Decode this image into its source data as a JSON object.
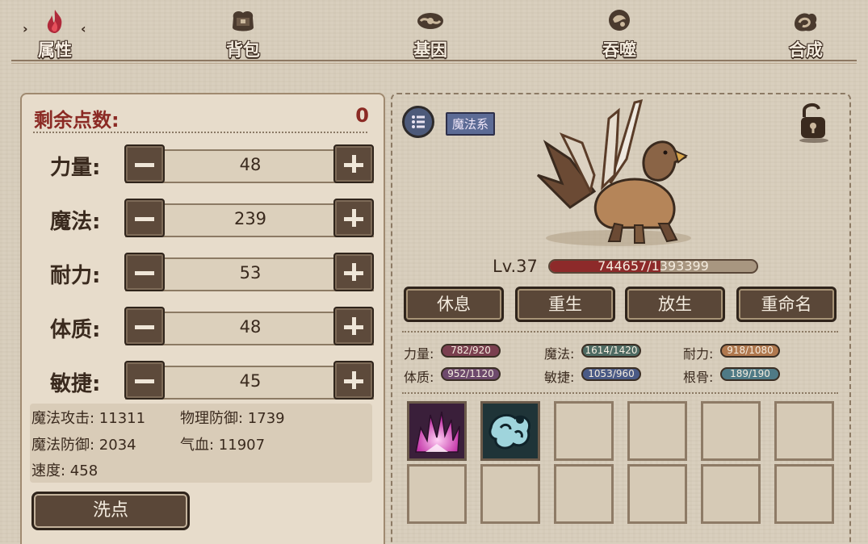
{
  "tabs": [
    {
      "label": "属性",
      "icon": "flame-icon",
      "active": true
    },
    {
      "label": "背包",
      "icon": "bag-icon",
      "active": false
    },
    {
      "label": "基因",
      "icon": "gene-icon",
      "active": false
    },
    {
      "label": "吞噬",
      "icon": "devour-icon",
      "active": false
    },
    {
      "label": "合成",
      "icon": "synthesis-icon",
      "active": false
    }
  ],
  "selection_arrows": {
    "left": "›",
    "right": "‹"
  },
  "points": {
    "label": "剩余点数:",
    "value": "0"
  },
  "stats": [
    {
      "label": "力量:",
      "value": "48"
    },
    {
      "label": "魔法:",
      "value": "239"
    },
    {
      "label": "耐力:",
      "value": "53"
    },
    {
      "label": "体质:",
      "value": "48"
    },
    {
      "label": "敏捷:",
      "value": "45"
    }
  ],
  "attributes": {
    "magic_attack": "魔法攻击: 11311",
    "physical_defense": "物理防御: 1739",
    "magic_defense": "魔法防御: 2034",
    "hp": "气血: 11907",
    "speed": "速度: 458"
  },
  "reset_button": "洗点",
  "pet": {
    "element": "魔法系",
    "level": "Lv.37",
    "exp_text": "744657/1393399",
    "exp_ratio": 0.534
  },
  "actions": [
    "休息",
    "重生",
    "放生",
    "重命名"
  ],
  "growth": [
    {
      "label": "力量:",
      "value": "782/920",
      "color": "#7a3f4f"
    },
    {
      "label": "魔法:",
      "value": "1614/1420",
      "color": "#4d6a62"
    },
    {
      "label": "耐力:",
      "value": "918/1080",
      "color": "#b0784e"
    },
    {
      "label": "体质:",
      "value": "952/1120",
      "color": "#6e4a6d"
    },
    {
      "label": "敏捷:",
      "value": "1053/960",
      "color": "#4a5a86"
    },
    {
      "label": "根骨:",
      "value": "189/190",
      "color": "#4f7a86"
    }
  ],
  "skills": [
    {
      "icon": "spike-burst-icon"
    },
    {
      "icon": "stone-fist-icon"
    }
  ]
}
